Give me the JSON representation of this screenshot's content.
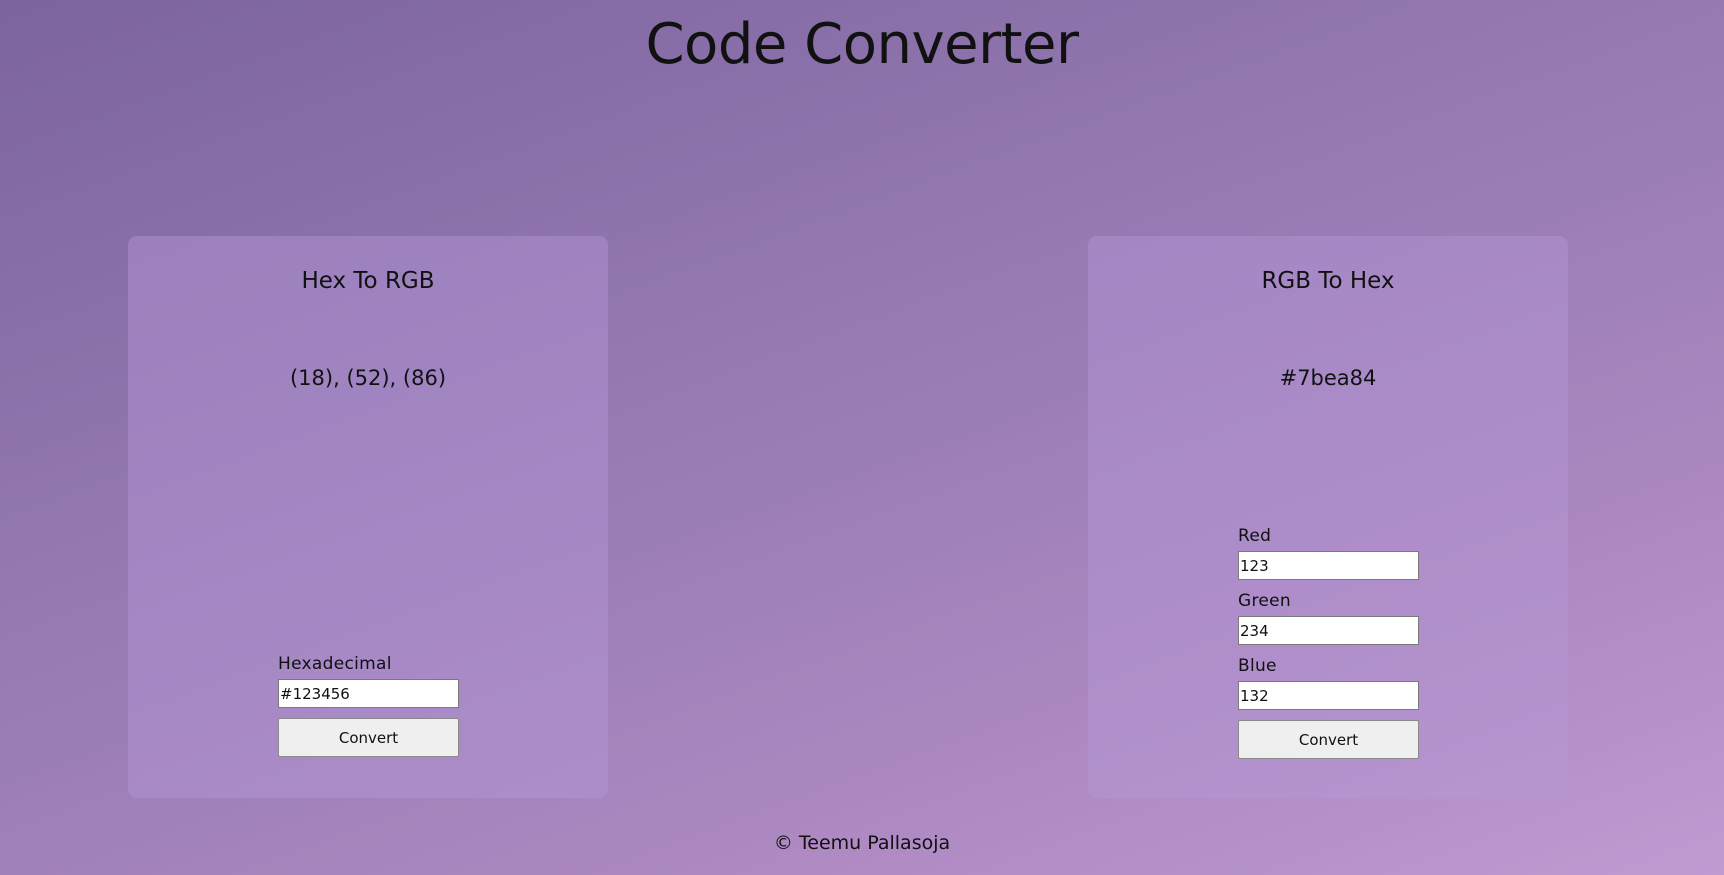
{
  "page": {
    "title": "Code Converter",
    "footer": "© Teemu Pallasoja"
  },
  "hex_to_rgb": {
    "title": "Hex To RGB",
    "result": "(18), (52), (86)",
    "hex_label": "Hexadecimal",
    "hex_value": "#123456",
    "convert_label": "Convert"
  },
  "rgb_to_hex": {
    "title": "RGB To Hex",
    "result": "#7bea84",
    "red_label": "Red",
    "red_value": "123",
    "green_label": "Green",
    "green_value": "234",
    "blue_label": "Blue",
    "blue_value": "132",
    "convert_label": "Convert"
  }
}
